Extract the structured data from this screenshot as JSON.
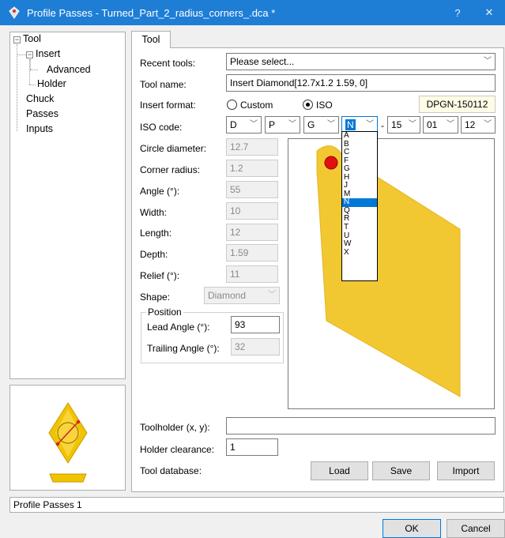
{
  "window": {
    "title": "Profile Passes - Turned_Part_2_radius_corners_.dca *",
    "help_label": "?",
    "close_label": "✕"
  },
  "tree": {
    "items": [
      {
        "label": "Tool"
      },
      {
        "label": "Insert"
      },
      {
        "label": "Advanced"
      },
      {
        "label": "Holder"
      },
      {
        "label": "Chuck"
      },
      {
        "label": "Passes"
      },
      {
        "label": "Inputs"
      }
    ]
  },
  "tab": {
    "label": "Tool"
  },
  "form": {
    "recent_tools": {
      "label": "Recent tools:",
      "value": "Please select..."
    },
    "tool_name": {
      "label": "Tool name:",
      "value": "Insert Diamond[12.7x1.2 1.59, 0]"
    },
    "insert_format": {
      "label": "Insert format:",
      "custom_label": "Custom",
      "iso_label": "ISO",
      "selected": "ISO",
      "iso_result": "DPGN-150112"
    },
    "iso_code": {
      "label": "ISO code:",
      "parts": [
        "D",
        "P",
        "G",
        "N",
        "15",
        "01",
        "12"
      ],
      "separator": "-"
    },
    "circle_diameter": {
      "label": "Circle diameter:",
      "value": "12.7"
    },
    "corner_radius": {
      "label": "Corner radius:",
      "value": "1.2"
    },
    "angle": {
      "label": "Angle (°):",
      "value": "55"
    },
    "width": {
      "label": "Width:",
      "value": "10"
    },
    "length": {
      "label": "Length:",
      "value": "12"
    },
    "depth": {
      "label": "Depth:",
      "value": "1.59"
    },
    "relief": {
      "label": "Relief (°):",
      "value": "11"
    },
    "shape": {
      "label": "Shape:",
      "value": "Diamond"
    },
    "position": {
      "title": "Position",
      "lead_angle": {
        "label": "Lead Angle (°):",
        "value": "93"
      },
      "trailing_angle": {
        "label": "Trailing Angle (°):",
        "value": "32"
      }
    },
    "toolholder": {
      "label": "Toolholder (x, y):",
      "value": ""
    },
    "holder_clearance": {
      "label": "Holder clearance:",
      "value": "1"
    },
    "tool_database": {
      "label": "Tool database:",
      "load": "Load",
      "save": "Save",
      "import": "Import"
    }
  },
  "iso_dropdown": {
    "options": [
      "A",
      "B",
      "C",
      "F",
      "G",
      "H",
      "J",
      "M",
      "N",
      "Q",
      "R",
      "T",
      "U",
      "W",
      "X"
    ],
    "selected": "N"
  },
  "status": {
    "text": "Profile Passes 1"
  },
  "footer": {
    "ok": "OK",
    "cancel": "Cancel"
  },
  "colors": {
    "titlebar": "#1e7ed6",
    "insert_fill": "#f2c832",
    "marker": "#e01010",
    "selection": "#0078d7"
  }
}
